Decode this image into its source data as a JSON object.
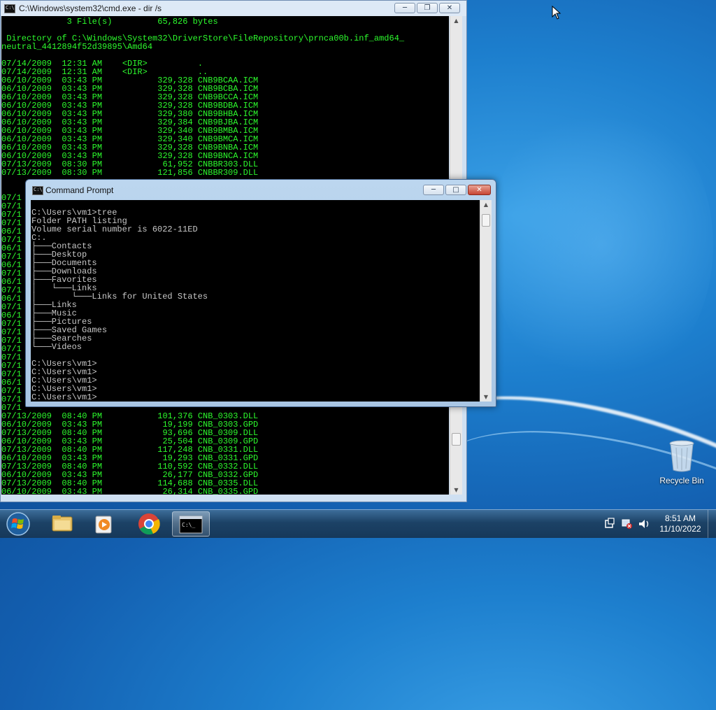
{
  "back_window": {
    "title": "C:\\Windows\\system32\\cmd.exe - dir /s",
    "top_lines": "             3 File(s)         65,826 bytes\n\n Directory of C:\\Windows\\System32\\DriverStore\\FileRepository\\prnca00b.inf_amd64_\nneutral_4412894f52d39895\\Amd64\n\n07/14/2009  12:31 AM    <DIR>          .\n07/14/2009  12:31 AM    <DIR>          ..\n06/10/2009  03:43 PM           329,328 CNB9BCAA.ICM\n06/10/2009  03:43 PM           329,328 CNB9BCBA.ICM\n06/10/2009  03:43 PM           329,328 CNB9BCCA.ICM\n06/10/2009  03:43 PM           329,328 CNB9BDBA.ICM\n06/10/2009  03:43 PM           329,380 CNB9BHBA.ICM\n06/10/2009  03:43 PM           329,384 CNB9BJBA.ICM\n06/10/2009  03:43 PM           329,340 CNB9BMBA.ICM\n06/10/2009  03:43 PM           329,340 CNB9BMCA.ICM\n06/10/2009  03:43 PM           329,328 CNB9BNBA.ICM\n06/10/2009  03:43 PM           329,328 CNB9BNCA.ICM\n07/13/2009  08:30 PM            61,952 CNBBR303.DLL\n07/13/2009  08:30 PM           121,856 CNBBR309.DLL",
    "left_fragments": "07/1\n07/1\n07/1\n07/1\n06/1\n07/1\n06/1\n07/1\n06/1\n07/1\n06/1\n07/1\n06/1\n07/1\n06/1\n07/1\n07/1\n07/1\n07/1\n07/1\n07/1\n07/1\n06/1\n07/1\n07/1\n07/1",
    "bottom_lines": "07/13/2009  08:40 PM           101,376 CNB_0303.DLL\n06/10/2009  03:43 PM            19,199 CNB_0303.GPD\n07/13/2009  08:40 PM            93,696 CNB_0309.DLL\n06/10/2009  03:43 PM            25,504 CNB_0309.GPD\n07/13/2009  08:40 PM           117,248 CNB_0331.DLL\n06/10/2009  03:43 PM            19,293 CNB_0331.GPD\n07/13/2009  08:40 PM           110,592 CNB_0332.DLL\n06/10/2009  03:43 PM            26,177 CNB_0332.GPD\n07/13/2009  08:40 PM           114,688 CNB_0335.DLL\n06/10/2009  03:43 PM            26,314 CNB_0335.GPD",
    "colors": {
      "text": "#2dfb2d",
      "background": "#000000"
    }
  },
  "front_window": {
    "title": "Command Prompt",
    "lines": "C:\\Users\\vm1>tree\nFolder PATH listing\nVolume serial number is 6022-11ED\nC:.\n├───Contacts\n├───Desktop\n├───Documents\n├───Downloads\n├───Favorites\n│   └───Links\n│       └───Links for United States\n├───Links\n├───Music\n├───Pictures\n├───Saved Games\n├───Searches\n└───Videos\n\nC:\\Users\\vm1>\nC:\\Users\\vm1>\nC:\\Users\\vm1>\nC:\\Users\\vm1>\nC:\\Users\\vm1>",
    "colors": {
      "text": "#c8c8c8",
      "background": "#000000"
    }
  },
  "window_controls": {
    "minimize": "─",
    "maximize": "□",
    "restore": "❐",
    "close": "✕"
  },
  "desktop": {
    "recycle_bin_label": "Recycle Bin"
  },
  "taskbar": {
    "items": [
      "start-button",
      "explorer",
      "media-player",
      "chrome",
      "command-prompt"
    ],
    "clock_time": "8:51 AM",
    "clock_date": "11/10/2022"
  }
}
